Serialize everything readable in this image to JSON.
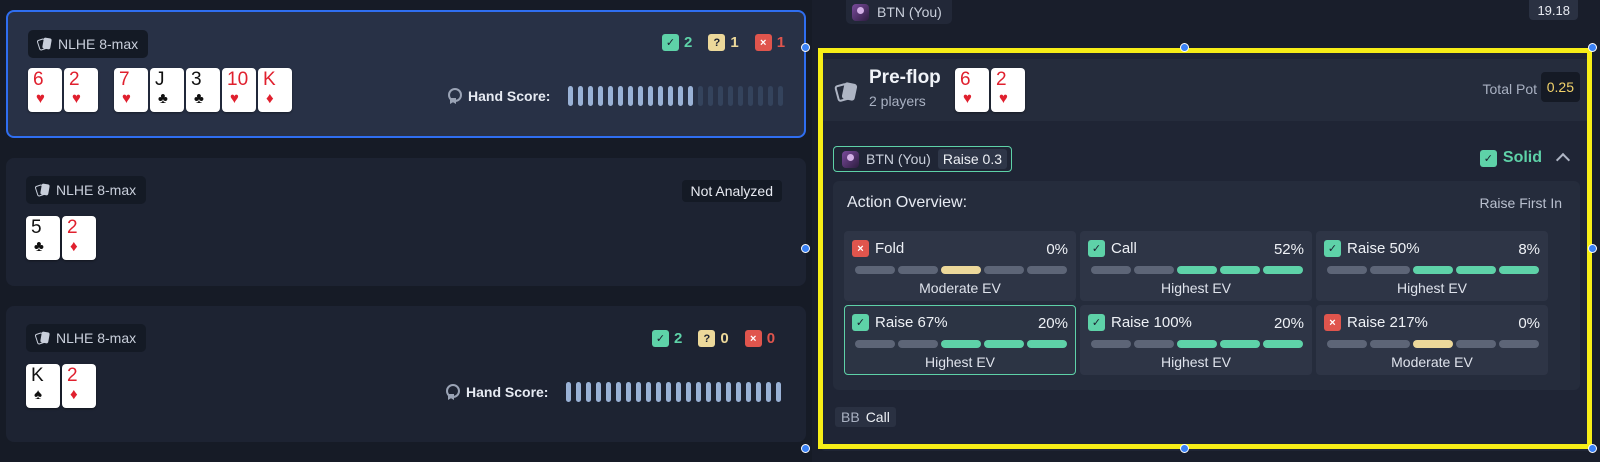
{
  "hands": [
    {
      "format": "NLHE 8-max",
      "hole_cards": [
        {
          "rank": "6",
          "suit": "♥",
          "color": "red"
        },
        {
          "rank": "2",
          "suit": "♥",
          "color": "red"
        }
      ],
      "board": [
        {
          "rank": "7",
          "suit": "♥",
          "color": "red"
        },
        {
          "rank": "J",
          "suit": "♣",
          "color": "black"
        },
        {
          "rank": "3",
          "suit": "♣",
          "color": "black"
        },
        {
          "rank": "10",
          "suit": "♥",
          "color": "red"
        },
        {
          "rank": "K",
          "suit": "♦",
          "color": "red"
        }
      ],
      "counts": {
        "good": "2",
        "unsure": "1",
        "bad": "1"
      },
      "score_label": "Hand Score:",
      "score_fraction": 0.58
    },
    {
      "format": "NLHE 8-max",
      "hole_cards": [
        {
          "rank": "5",
          "suit": "♣",
          "color": "black"
        },
        {
          "rank": "2",
          "suit": "♦",
          "color": "red"
        }
      ],
      "status": "Not Analyzed"
    },
    {
      "format": "NLHE 8-max",
      "hole_cards": [
        {
          "rank": "K",
          "suit": "♠",
          "color": "black"
        },
        {
          "rank": "2",
          "suit": "♦",
          "color": "red"
        }
      ],
      "counts": {
        "good": "2",
        "unsure": "0",
        "bad": "0"
      },
      "score_label": "Hand Score:",
      "score_fraction": 1.0
    }
  ],
  "top": {
    "player": "BTN (You)",
    "stack": "19.18"
  },
  "street": {
    "title": "Pre-flop",
    "players": "2 players",
    "cards": [
      {
        "rank": "6",
        "suit": "♥",
        "color": "red"
      },
      {
        "rank": "2",
        "suit": "♥",
        "color": "red"
      }
    ],
    "total_pot_label": "Total Pot",
    "total_pot": "0.25"
  },
  "action": {
    "player": "BTN (You)",
    "action": "Raise 0.3",
    "grade": "Solid"
  },
  "overview": {
    "title": "Action Overview:",
    "context": "Raise First In",
    "options": [
      {
        "name": "Fold",
        "pct": "0%",
        "status": "bad",
        "ev": "Moderate EV",
        "segments": [
          "n",
          "n",
          "y",
          "n",
          "n"
        ],
        "highlight": false
      },
      {
        "name": "Call",
        "pct": "52%",
        "status": "good",
        "ev": "Highest EV",
        "segments": [
          "n",
          "n",
          "g",
          "g",
          "g"
        ],
        "highlight": false
      },
      {
        "name": "Raise 50%",
        "pct": "8%",
        "status": "good",
        "ev": "Highest EV",
        "segments": [
          "n",
          "n",
          "g",
          "g",
          "g"
        ],
        "highlight": false
      },
      {
        "name": "Raise 67%",
        "pct": "20%",
        "status": "good",
        "ev": "Highest EV",
        "segments": [
          "n",
          "n",
          "g",
          "g",
          "g"
        ],
        "highlight": true
      },
      {
        "name": "Raise 100%",
        "pct": "20%",
        "status": "good",
        "ev": "Highest EV",
        "segments": [
          "n",
          "n",
          "g",
          "g",
          "g"
        ],
        "highlight": false
      },
      {
        "name": "Raise 217%",
        "pct": "0%",
        "status": "bad",
        "ev": "Moderate EV",
        "segments": [
          "n",
          "n",
          "y",
          "n",
          "n"
        ],
        "highlight": false
      }
    ]
  },
  "next": {
    "player": "BB",
    "action": "Call"
  },
  "colors": {
    "good": "#5ed2a8",
    "unsure": "#ecd89a",
    "bad": "#e0554d",
    "selection": "#f7ee17",
    "selected_border": "#2f6ef0"
  },
  "icons": {
    "check": "✓",
    "question": "?",
    "cross": "×"
  }
}
